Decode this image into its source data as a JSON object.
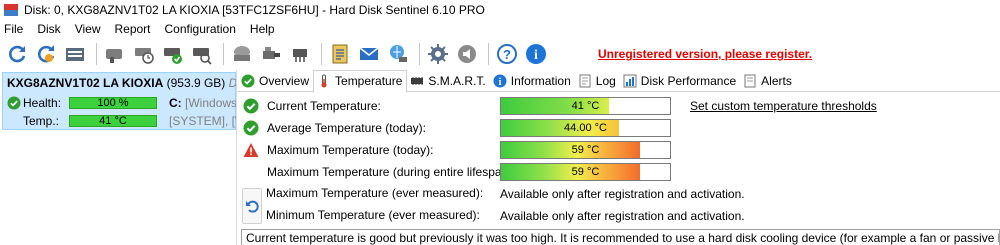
{
  "window": {
    "title": "Disk: 0, KXG8AZNV1T02 LA KIOXIA [53TFC1ZSF6HU]  -  Hard Disk Sentinel 6.10 PRO"
  },
  "menu": [
    "File",
    "Disk",
    "View",
    "Report",
    "Configuration",
    "Help"
  ],
  "toolbar": {
    "icons": [
      "refresh-icon",
      "refresh-all-icon",
      "disk-info-icon",
      "disk-test-icon",
      "disk-timer-icon",
      "disk-check-icon",
      "disk-search-icon",
      "disk-gray-icon",
      "disk-connect-icon",
      "disk-shredder-icon",
      "report-icon",
      "email-icon",
      "network-icon",
      "settings-icon",
      "sound-icon",
      "help-icon",
      "info-icon"
    ],
    "unregistered_label": "Unregistered version, please register."
  },
  "disk": {
    "name": "KXG8AZNV1T02 LA KIOXIA",
    "size": "(953.9 GB)",
    "suffix": "Disk",
    "health_label": "Health:",
    "health_value": "100 %",
    "health_drive": "C:",
    "health_extra": "[Windows],",
    "temp_label": "Temp.:",
    "temp_value": "41 °C",
    "temp_extra": "[SYSTEM],  [WinR"
  },
  "tabs": [
    {
      "label": "Overview",
      "icon": "check-icon"
    },
    {
      "label": "Temperature",
      "icon": "thermometer-icon"
    },
    {
      "label": "S.M.A.R.T.",
      "icon": "chip-icon"
    },
    {
      "label": "Information",
      "icon": "info-icon"
    },
    {
      "label": "Log",
      "icon": "log-icon"
    },
    {
      "label": "Disk Performance",
      "icon": "chart-icon"
    },
    {
      "label": "Alerts",
      "icon": "alert-icon"
    }
  ],
  "temperature": {
    "current_label": "Current Temperature:",
    "current_value": "41 °C",
    "current_fill": 0.64,
    "average_label": "Average Temperature (today):",
    "average_value": "44.00 °C",
    "average_fill": 0.7,
    "max_today_label": "Maximum Temperature (today):",
    "max_today_value": "59 °C",
    "max_today_fill": 0.82,
    "max_life_label": "Maximum Temperature (during entire lifespan):",
    "max_life_value": "59 °C",
    "max_life_fill": 0.82,
    "max_ever_label": "Maximum Temperature (ever measured):",
    "max_ever_value": "Available only after registration and activation.",
    "min_ever_label": "Minimum Temperature (ever measured):",
    "min_ever_value": "Available only after registration and activation.",
    "set_thresholds_link": "Set custom temperature thresholds",
    "message": "Current temperature is good but previously it was too high. It is recommended to use a hard disk cooling device (for example a fan or passive heatsink) if possible."
  },
  "colors": {
    "ok_green": "#2f9e2f",
    "warn_red": "#d93a2b",
    "selection": "#cce8ff",
    "unregistered_red": "#e00000"
  }
}
